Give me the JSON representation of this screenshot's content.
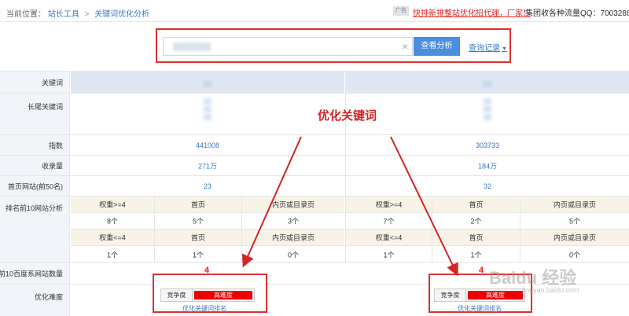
{
  "breadcrumb": {
    "prefix": "当前位置：",
    "root": "站长工具",
    "separator": ">",
    "current": "关键词优化分析"
  },
  "promo": {
    "badge": "广告",
    "text": "快排新排整站优化招代理，厂家！",
    "qq": "集团收各种流量QQ：7003288"
  },
  "search": {
    "value": "",
    "button": "查看分析",
    "history": "查询记录"
  },
  "overlay": {
    "title": "优化关键词"
  },
  "labels": {
    "keyword": "关键词",
    "longtail": "长尾关键词",
    "index": "指数",
    "indexed": "收录量",
    "first_page": "首页网站(前50名)",
    "top10": "排名前10网站分析",
    "baidu_count": "前10百度系网站数量",
    "difficulty": "优化难度"
  },
  "columns": [
    {
      "index": "441008",
      "indexed": "271万",
      "first_page": "23",
      "h1": [
        "权重>=4",
        "首页",
        "内页或目录页"
      ],
      "r1": [
        "8个",
        "5个",
        "3个"
      ],
      "h2": [
        "权重<=4",
        "首页",
        "内页或目录页"
      ],
      "r2": [
        "1个",
        "1个",
        "0个"
      ],
      "baidu_count": "4",
      "comp_label": "竞争度",
      "comp_text": "高难度",
      "opt_link": "优化关键词排名"
    },
    {
      "index": "303733",
      "indexed": "184万",
      "first_page": "32",
      "h1": [
        "权重>=4",
        "首页",
        "内页或目录页"
      ],
      "r1": [
        "7个",
        "2个",
        "5个"
      ],
      "h2": [
        "权重<=4",
        "首页",
        "内页或目录页"
      ],
      "r2": [
        "1个",
        "1个",
        "0个"
      ],
      "baidu_count": "4",
      "comp_label": "竞争度",
      "comp_text": "高难度",
      "opt_link": "优化关键词排名"
    }
  ],
  "watermark": {
    "main": "Baidu 经验",
    "sub": "jingyan.baidu.com"
  },
  "colors": {
    "accent": "#4a8ee0",
    "link": "#3a78c3",
    "highlight_border": "#e03030",
    "difficulty_bar": "#ee0000"
  }
}
